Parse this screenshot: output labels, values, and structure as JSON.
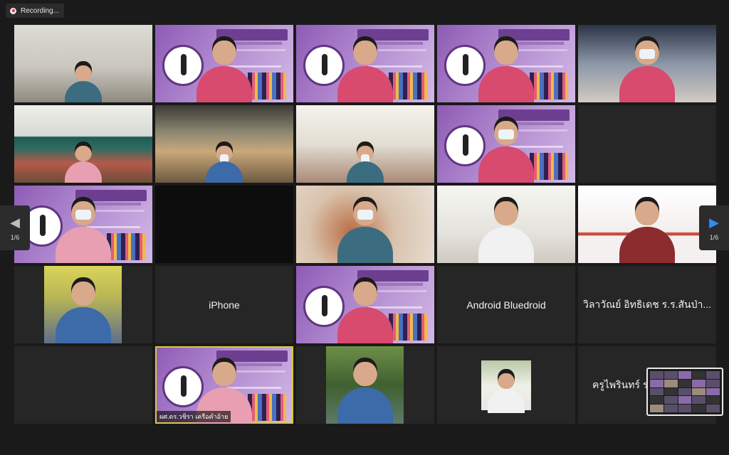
{
  "recording": {
    "label": "Recording..."
  },
  "navigation": {
    "left_page": "1/6",
    "right_page": "1/6"
  },
  "participants": {
    "iphone": "iPhone",
    "android": "Android Bluedroid",
    "participant_thai_1": "วิลาวัณย์ อิทธิเดช ร.ร.สันป่า...",
    "participant_thai_2": "ครูไพรินทร์ ร",
    "speaker_label": "ผศ.ดร.วชิรา เครือคำอ้าย"
  },
  "colors": {
    "active_speaker_border": "#d8c940",
    "nav_arrow_active": "#2d8cff"
  }
}
